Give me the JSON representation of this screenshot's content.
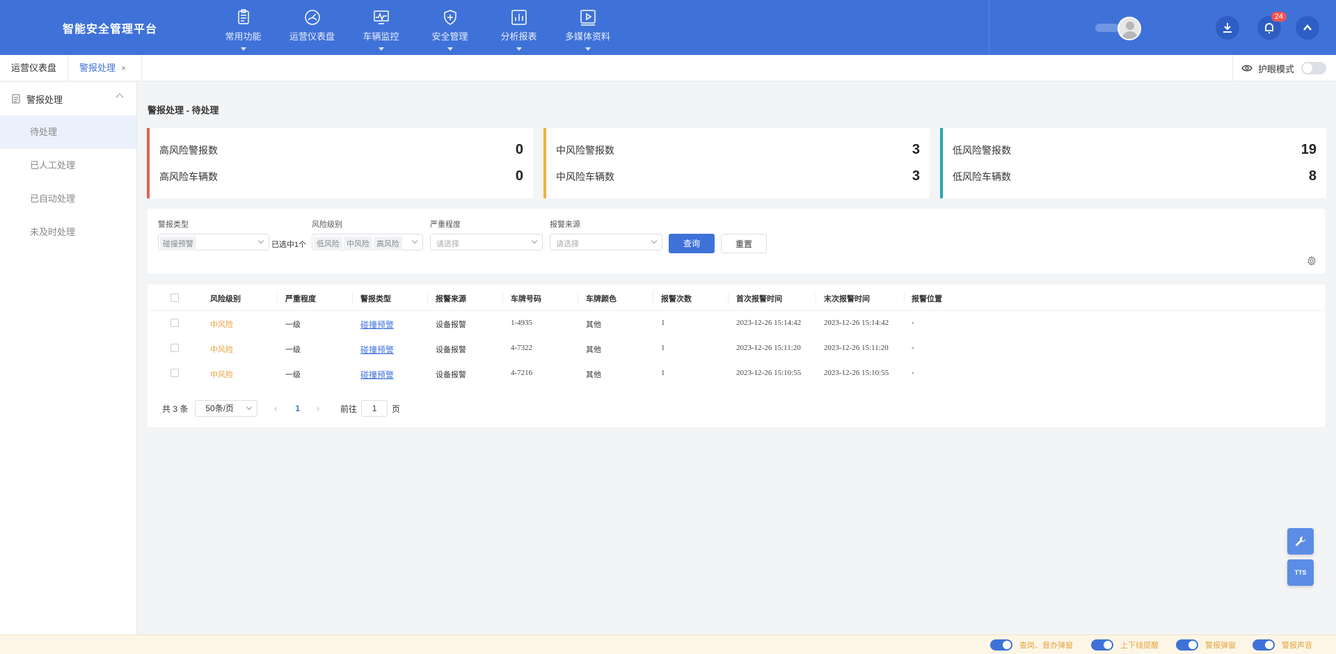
{
  "header": {
    "logo": "智能安全管理平台",
    "nav": [
      {
        "label": "常用功能",
        "icon": "clipboard-icon",
        "has_caret": true
      },
      {
        "label": "运营仪表盘",
        "icon": "gauge-icon",
        "has_caret": false
      },
      {
        "label": "车辆监控",
        "icon": "monitor-icon",
        "has_caret": true
      },
      {
        "label": "安全管理",
        "icon": "shield-icon",
        "has_caret": true
      },
      {
        "label": "分析报表",
        "icon": "bar-chart-icon",
        "has_caret": true
      },
      {
        "label": "多媒体资料",
        "icon": "video-icon",
        "has_caret": true
      }
    ],
    "notification_count": "24",
    "colors": {
      "primary": "#3f72d8"
    }
  },
  "tabs": [
    {
      "label": "运营仪表盘",
      "active": false
    },
    {
      "label": "警报处理",
      "active": true,
      "close": "×"
    }
  ],
  "eye_mode": {
    "label": "护眼模式",
    "enabled": false
  },
  "sidebar": {
    "group": "警报处理",
    "items": [
      {
        "label": "待处理",
        "active": true
      },
      {
        "label": "已人工处理",
        "active": false
      },
      {
        "label": "已自动处理",
        "active": false
      },
      {
        "label": "未及时处理",
        "active": false
      }
    ]
  },
  "page_title": "警报处理 - 待处理",
  "stats": [
    {
      "color": "#e8604c",
      "rows": [
        {
          "label": "高风险警报数",
          "value": "0"
        },
        {
          "label": "高风险车辆数",
          "value": "0"
        }
      ]
    },
    {
      "color": "#f0b23e",
      "rows": [
        {
          "label": "中风险警报数",
          "value": "3"
        },
        {
          "label": "中风险车辆数",
          "value": "3"
        }
      ]
    },
    {
      "color": "#2aa3b6",
      "rows": [
        {
          "label": "低风险警报数",
          "value": "19"
        },
        {
          "label": "低风险车辆数",
          "value": "8"
        }
      ]
    }
  ],
  "filters": {
    "alarm_type": {
      "label": "警报类型",
      "tag": "碰撞预警",
      "selected_note": "已选中1个"
    },
    "risk_level": {
      "label": "风险级别",
      "tags": [
        "低风险",
        "中风险",
        "高风险"
      ]
    },
    "severity": {
      "label": "严重程度",
      "placeholder": "请选择"
    },
    "source": {
      "label": "报警来源",
      "placeholder": "请选择"
    },
    "query_btn": "查询",
    "reset_btn": "重置"
  },
  "table": {
    "columns": [
      "风险级别",
      "严重程度",
      "警报类型",
      "报警来源",
      "车牌号码",
      "车牌颜色",
      "报警次数",
      "首次报警时间",
      "末次报警时间",
      "报警位置"
    ],
    "rows": [
      [
        "中风险",
        "一级",
        "碰撞预警",
        "设备报警",
        "1-4935",
        "其他",
        "1",
        "2023-12-26 15:14:42",
        "2023-12-26 15:14:42",
        "-"
      ],
      [
        "中风险",
        "一级",
        "碰撞预警",
        "设备报警",
        "4-7322",
        "其他",
        "1",
        "2023-12-26 15:11:20",
        "2023-12-26 15:11:20",
        "-"
      ],
      [
        "中风险",
        "一级",
        "碰撞预警",
        "设备报警",
        "4-7216",
        "其他",
        "1",
        "2023-12-26 15:10:55",
        "2023-12-26 15:10:55",
        "-"
      ]
    ]
  },
  "pager": {
    "total": "共 3 条",
    "page_size": "50条/页",
    "prev": "‹",
    "current": "1",
    "next": "›",
    "goto_prefix": "前往",
    "goto_value": "1",
    "goto_suffix": "页"
  },
  "float_buttons": {
    "tts": "TTS"
  },
  "footer": [
    {
      "label": "查岗、督办弹窗"
    },
    {
      "label": "上下线提醒"
    },
    {
      "label": "警报弹窗"
    },
    {
      "label": "警报声音"
    }
  ]
}
